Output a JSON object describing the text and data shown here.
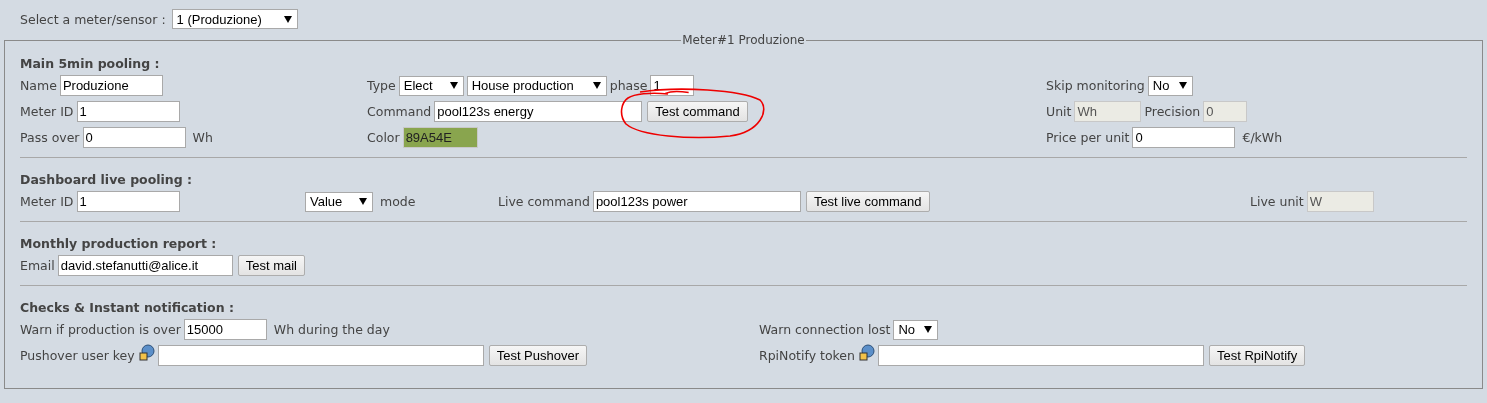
{
  "selector": {
    "label": "Select a meter/sensor :",
    "value": "1 (Produzione)"
  },
  "legend": "Meter#1 Produzione",
  "sections": [
    {
      "kind": "main",
      "title": "Main 5min pooling :",
      "columns": [
        [
          [
            {
              "kind": "label",
              "text": "Name"
            },
            {
              "kind": "input",
              "value": "Produzione",
              "disabled": false
            }
          ],
          [
            {
              "kind": "label",
              "text": "Meter ID"
            },
            {
              "kind": "input",
              "value": "1",
              "disabled": false
            }
          ],
          [
            {
              "kind": "label",
              "text": "Pass over"
            },
            {
              "kind": "input",
              "value": "0",
              "disabled": false
            },
            {
              "kind": "unit",
              "text": "Wh"
            }
          ]
        ],
        [
          [
            {
              "kind": "label",
              "text": "Type"
            },
            {
              "kind": "select",
              "value": "Elect"
            },
            {
              "kind": "select",
              "value": "House production"
            },
            {
              "kind": "label",
              "text": "phase"
            },
            {
              "kind": "input",
              "value": "1",
              "disabled": false,
              "annotated": true
            }
          ],
          [
            {
              "kind": "label",
              "text": "Command"
            },
            {
              "kind": "input",
              "value": "pool123s energy",
              "disabled": false
            },
            {
              "kind": "button",
              "text": "Test command",
              "annotated": true
            }
          ],
          [
            {
              "kind": "label",
              "text": "Color"
            },
            {
              "kind": "color",
              "value": "89A54E",
              "color": "#89a54e"
            }
          ]
        ],
        [
          [
            {
              "kind": "label",
              "text": "Skip monitoring"
            },
            {
              "kind": "select",
              "value": "No"
            }
          ],
          [
            {
              "kind": "label",
              "text": "Unit"
            },
            {
              "kind": "input",
              "value": "Wh",
              "disabled": true
            },
            {
              "kind": "label",
              "text": "Precision"
            },
            {
              "kind": "input",
              "value": "0",
              "disabled": true
            }
          ],
          [
            {
              "kind": "label",
              "text": "Price per unit"
            },
            {
              "kind": "input",
              "value": "0",
              "disabled": false
            },
            {
              "kind": "unit",
              "text": "€/kWh"
            }
          ]
        ]
      ]
    },
    {
      "kind": "live",
      "title": "Dashboard live pooling :",
      "columns": [
        [
          [
            {
              "kind": "label",
              "text": "Meter ID"
            },
            {
              "kind": "input",
              "value": "1",
              "disabled": false
            }
          ]
        ],
        [
          [
            {
              "kind": "select",
              "value": "Value"
            },
            {
              "kind": "unit",
              "text": "mode"
            }
          ]
        ],
        [
          [
            {
              "kind": "label",
              "text": "Live command"
            },
            {
              "kind": "input",
              "value": "pool123s power",
              "disabled": false
            },
            {
              "kind": "button",
              "text": "Test live command",
              "annotated": false
            }
          ]
        ],
        [
          [
            {
              "kind": "label",
              "text": "Live unit"
            },
            {
              "kind": "input",
              "value": "W",
              "disabled": true
            }
          ]
        ]
      ]
    },
    {
      "kind": "report",
      "title": "Monthly production report :",
      "columns": [
        [
          [
            {
              "kind": "label",
              "text": "Email"
            },
            {
              "kind": "input",
              "value": "david.stefanutti@alice.it",
              "disabled": false
            },
            {
              "kind": "button",
              "text": "Test mail",
              "annotated": false
            }
          ]
        ]
      ]
    },
    {
      "kind": "checks",
      "title": "Checks & Instant notification :",
      "columns": [
        [
          [
            {
              "kind": "label",
              "text": "Warn if production is over"
            },
            {
              "kind": "input",
              "value": "15000",
              "disabled": false
            },
            {
              "kind": "unit",
              "text": "Wh during the day"
            }
          ],
          [
            {
              "kind": "label",
              "text": "Pushover user key"
            },
            {
              "kind": "key"
            },
            {
              "kind": "input",
              "disabled": false
            },
            {
              "kind": "button",
              "text": "Test Pushover",
              "annotated": false
            }
          ]
        ],
        [
          [
            {
              "kind": "label",
              "text": "Warn connection lost"
            },
            {
              "kind": "select",
              "value": "No"
            }
          ],
          [
            {
              "kind": "label",
              "text": "RpiNotify token"
            },
            {
              "kind": "key"
            },
            {
              "kind": "input",
              "disabled": false
            },
            {
              "kind": "button",
              "text": "Test RpiNotify",
              "annotated": false
            }
          ]
        ]
      ]
    }
  ]
}
